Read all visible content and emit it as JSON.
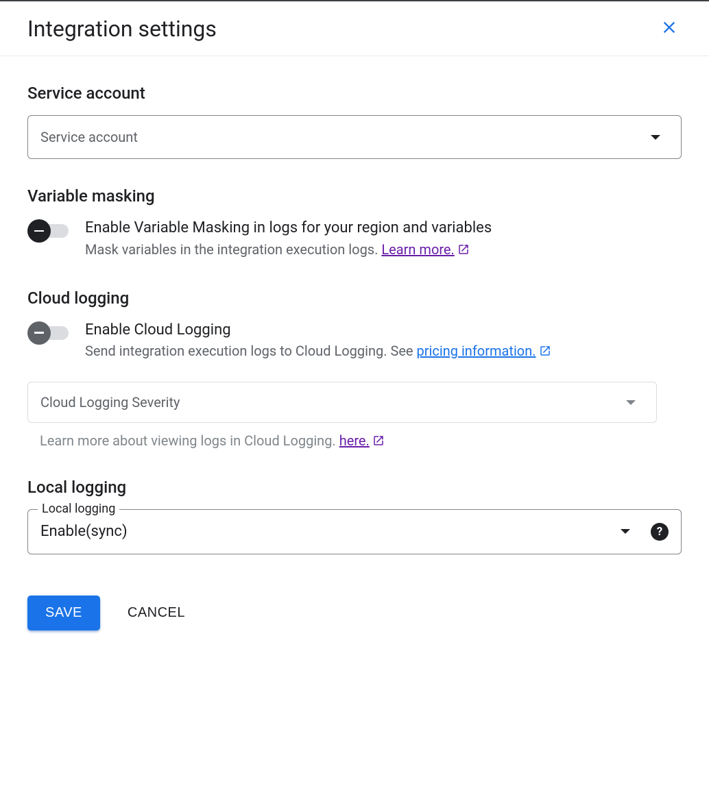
{
  "header": {
    "title": "Integration settings"
  },
  "serviceAccount": {
    "title": "Service account",
    "placeholder": "Service account"
  },
  "variableMasking": {
    "title": "Variable masking",
    "toggleLabel": "Enable Variable Masking in logs for your region and variables",
    "descPrefix": "Mask variables in the integration execution logs. ",
    "learnMore": "Learn more."
  },
  "cloudLogging": {
    "title": "Cloud logging",
    "toggleLabel": "Enable Cloud Logging",
    "descPrefix": "Send integration execution logs to Cloud Logging. See ",
    "pricingLink": "pricing information.",
    "severityPlaceholder": "Cloud Logging Severity",
    "helperPrefix": "Learn more about viewing logs in Cloud Logging. ",
    "helperLink": "here."
  },
  "localLogging": {
    "title": "Local logging",
    "fieldLabel": "Local logging",
    "value": "Enable(sync)"
  },
  "actions": {
    "save": "SAVE",
    "cancel": "CANCEL"
  }
}
